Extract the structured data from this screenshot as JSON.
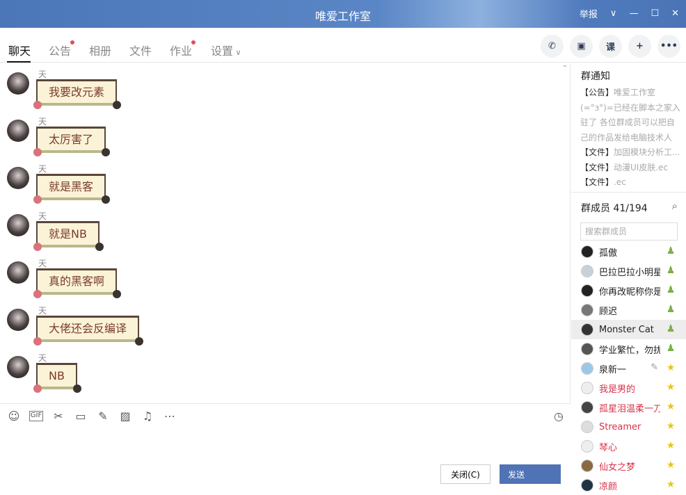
{
  "window": {
    "title": "唯爱工作室",
    "report": "举报"
  },
  "tabs": [
    {
      "label": "聊天",
      "active": true,
      "dot": false
    },
    {
      "label": "公告",
      "dot": true
    },
    {
      "label": "相册",
      "dot": false
    },
    {
      "label": "文件",
      "dot": false
    },
    {
      "label": "作业",
      "dot": true
    },
    {
      "label": "设置",
      "dot": false
    }
  ],
  "tools": [
    {
      "icon": "phone-icon",
      "glyph": "✆"
    },
    {
      "icon": "video-icon",
      "glyph": "▣"
    },
    {
      "icon": "class-icon",
      "glyph": "课"
    },
    {
      "icon": "add-app-icon",
      "glyph": "+"
    },
    {
      "icon": "more-icon",
      "glyph": "•••"
    }
  ],
  "messages": [
    {
      "sender": "天域",
      "text": "我要改元素"
    },
    {
      "sender": "天域",
      "text": "太厉害了"
    },
    {
      "sender": "天域",
      "text": "就是黑客"
    },
    {
      "sender": "天域",
      "text": "就是NB"
    },
    {
      "sender": "天域",
      "text": "真的黑客啊"
    },
    {
      "sender": "天域",
      "text": "大佬还会反编译"
    },
    {
      "sender": "天域",
      "text": "NB"
    }
  ],
  "input": {
    "toolbar": [
      "emoji-icon",
      "gif-icon",
      "screenshot-icon",
      "folder-icon",
      "doodle-icon",
      "image-icon",
      "bell-icon",
      "more-icon"
    ],
    "close_label": "关闭(C)",
    "send_label": "发送"
  },
  "notice": {
    "title": "群通知",
    "items": [
      {
        "tag": "【公告】",
        "text": "唯爱工作室(=°з°)=已经在脚本之家入驻了 各位群成员可以把自己的作品发给电脑技术人员..."
      },
      {
        "tag": "【文件】",
        "text": "加固模块分析工..."
      },
      {
        "tag": "【文件】",
        "text": "动漫UI皮肤.ec"
      },
      {
        "tag": "【文件】",
        "text": ".ec"
      }
    ]
  },
  "members": {
    "title": "群成员 41/194",
    "search_placeholder": "搜索群成员",
    "list": [
      {
        "name": "孤傲",
        "badge": "admin",
        "red": false
      },
      {
        "name": "巴拉巴拉小明星",
        "badge": "admin",
        "red": false
      },
      {
        "name": "你再改昵称你是",
        "badge": "admin",
        "red": false
      },
      {
        "name": "顾迟",
        "badge": "admin",
        "red": false
      },
      {
        "name": "Monster Cat",
        "badge": "admin",
        "red": false,
        "highlight": true
      },
      {
        "name": "学业繁忙，勿扰",
        "badge": "admin",
        "red": false
      },
      {
        "name": "泉新一",
        "badge": "star",
        "red": false,
        "edit": true
      },
      {
        "name": "我是男的",
        "badge": "star",
        "red": true
      },
      {
        "name": "孤星泪温柔一刀",
        "badge": "star",
        "red": true
      },
      {
        "name": "Streamer",
        "badge": "star",
        "red": true
      },
      {
        "name": "琴心",
        "badge": "star",
        "red": true
      },
      {
        "name": "仙女之梦",
        "badge": "star",
        "red": true
      },
      {
        "name": "凉颜",
        "badge": "star",
        "red": true
      }
    ]
  },
  "colors": {
    "titlebar": "#4b76b8",
    "send": "#5073b6",
    "red_name": "#d8334a",
    "bubble_text": "#7a3b2b"
  }
}
